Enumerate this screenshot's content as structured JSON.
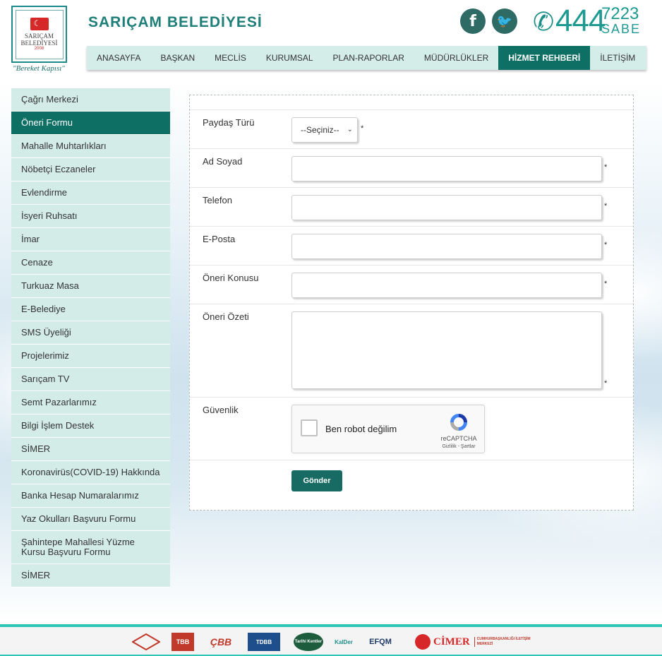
{
  "header": {
    "logo_line1": "SARIÇAM",
    "logo_line2": "BELEDİYESİ",
    "logo_year": "2008",
    "slogan": "\"Bereket Kapısı\"",
    "title": "SARIÇAM BELEDİYESİ",
    "facebook": "f",
    "twitter": "🐦",
    "phone_main": "444",
    "phone_sub1": "7223",
    "phone_sub2": "SABE"
  },
  "nav": {
    "items": [
      "ANASAYFA",
      "BAŞKAN",
      "MECLİS",
      "KURUMSAL",
      "PLAN-RAPORLAR",
      "MÜDÜRLÜKLER",
      "HİZMET REHBERİ",
      "İLETİŞİM"
    ],
    "active_index": 6
  },
  "sidebar": {
    "items": [
      "Çağrı Merkezi",
      "Öneri Formu",
      "Mahalle Muhtarlıkları",
      "Nöbetçi Eczaneler",
      "Evlendirme",
      "İsyeri Ruhsatı",
      "İmar",
      "Cenaze",
      "Turkuaz Masa",
      "E-Belediye",
      "SMS Üyeliği",
      "Projelerimiz",
      "Sarıçam TV",
      "Semt Pazarlarımız",
      "Bilgi İşlem Destek",
      "SİMER",
      "Koronavirüs(COVID-19) Hakkında",
      "Banka Hesap Numaralarımız",
      "Yaz Okulları Başvuru Formu",
      "Şahintepe Mahallesi Yüzme Kursu Başvuru Formu",
      "SİMER"
    ],
    "active_index": 1
  },
  "form": {
    "paydas_label": "Paydaş Türü",
    "paydas_value": "--Seçiniz--",
    "adsoyad_label": "Ad Soyad",
    "adsoyad_value": "",
    "telefon_label": "Telefon",
    "telefon_value": "",
    "eposta_label": "E-Posta",
    "eposta_value": "",
    "konu_label": "Öneri Konusu",
    "konu_value": "",
    "ozet_label": "Öneri Özeti",
    "ozet_value": "",
    "guvenlik_label": "Güvenlik",
    "required_mark": "*",
    "submit_label": "Gönder"
  },
  "captcha": {
    "text": "Ben robot değilim",
    "brand": "reCAPTCHA",
    "links": "Gizlilik - Şartlar"
  },
  "footer": {
    "logos": [
      "TSE",
      "TBB",
      "ÇBB",
      "TDBB",
      "Tarihi Kentler",
      "KalDer",
      "EFQM",
      "CİMER"
    ],
    "cimer_sub": "CUMHURBAŞKANLIĞI İLETİŞİM MERKEZİ"
  },
  "colors": {
    "primary": "#0e6f64",
    "accent": "#1e9a92",
    "sidebar_bg": "#d3ece8",
    "footer_accent": "#2ec4b6"
  }
}
